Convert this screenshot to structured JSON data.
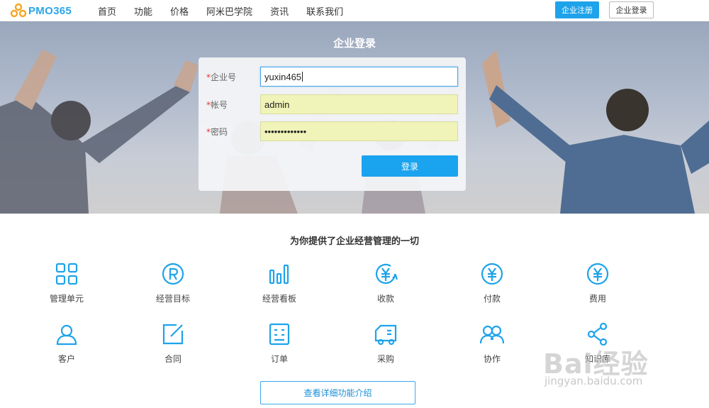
{
  "brand": {
    "logo_text": "PMO365",
    "accent": "#1ea3ea"
  },
  "nav": {
    "items": [
      "首页",
      "功能",
      "价格",
      "阿米巴学院",
      "资讯",
      "联系我们"
    ],
    "register_label": "企业注册",
    "login_label": "企业登录"
  },
  "hero": {
    "title": "企业登录",
    "form": {
      "company": {
        "label": "企业号",
        "value": "yuxin465"
      },
      "account": {
        "label": "帐号",
        "value": "admin"
      },
      "password": {
        "label": "密码",
        "value": "•••••••••••••"
      },
      "required_mark": "*",
      "submit_label": "登录"
    }
  },
  "features": {
    "title": "为你提供了企业经营管理的一切",
    "items": [
      {
        "label": "管理单元",
        "icon": "grid-icon"
      },
      {
        "label": "经营目标",
        "icon": "registered-icon"
      },
      {
        "label": "经营看板",
        "icon": "bar-chart-icon"
      },
      {
        "label": "收款",
        "icon": "yen-refresh-icon"
      },
      {
        "label": "付款",
        "icon": "yen-circle-icon"
      },
      {
        "label": "费用",
        "icon": "yen-circle-icon"
      },
      {
        "label": "客户",
        "icon": "user-icon"
      },
      {
        "label": "合同",
        "icon": "edit-icon"
      },
      {
        "label": "订单",
        "icon": "list-icon"
      },
      {
        "label": "采购",
        "icon": "truck-icon"
      },
      {
        "label": "协作",
        "icon": "users-icon"
      },
      {
        "label": "知识库",
        "icon": "share-icon"
      }
    ],
    "detail_button": "查看详细功能介绍"
  },
  "watermark": {
    "main": "Bai经验",
    "sub": "jingyan.baidu.com"
  }
}
